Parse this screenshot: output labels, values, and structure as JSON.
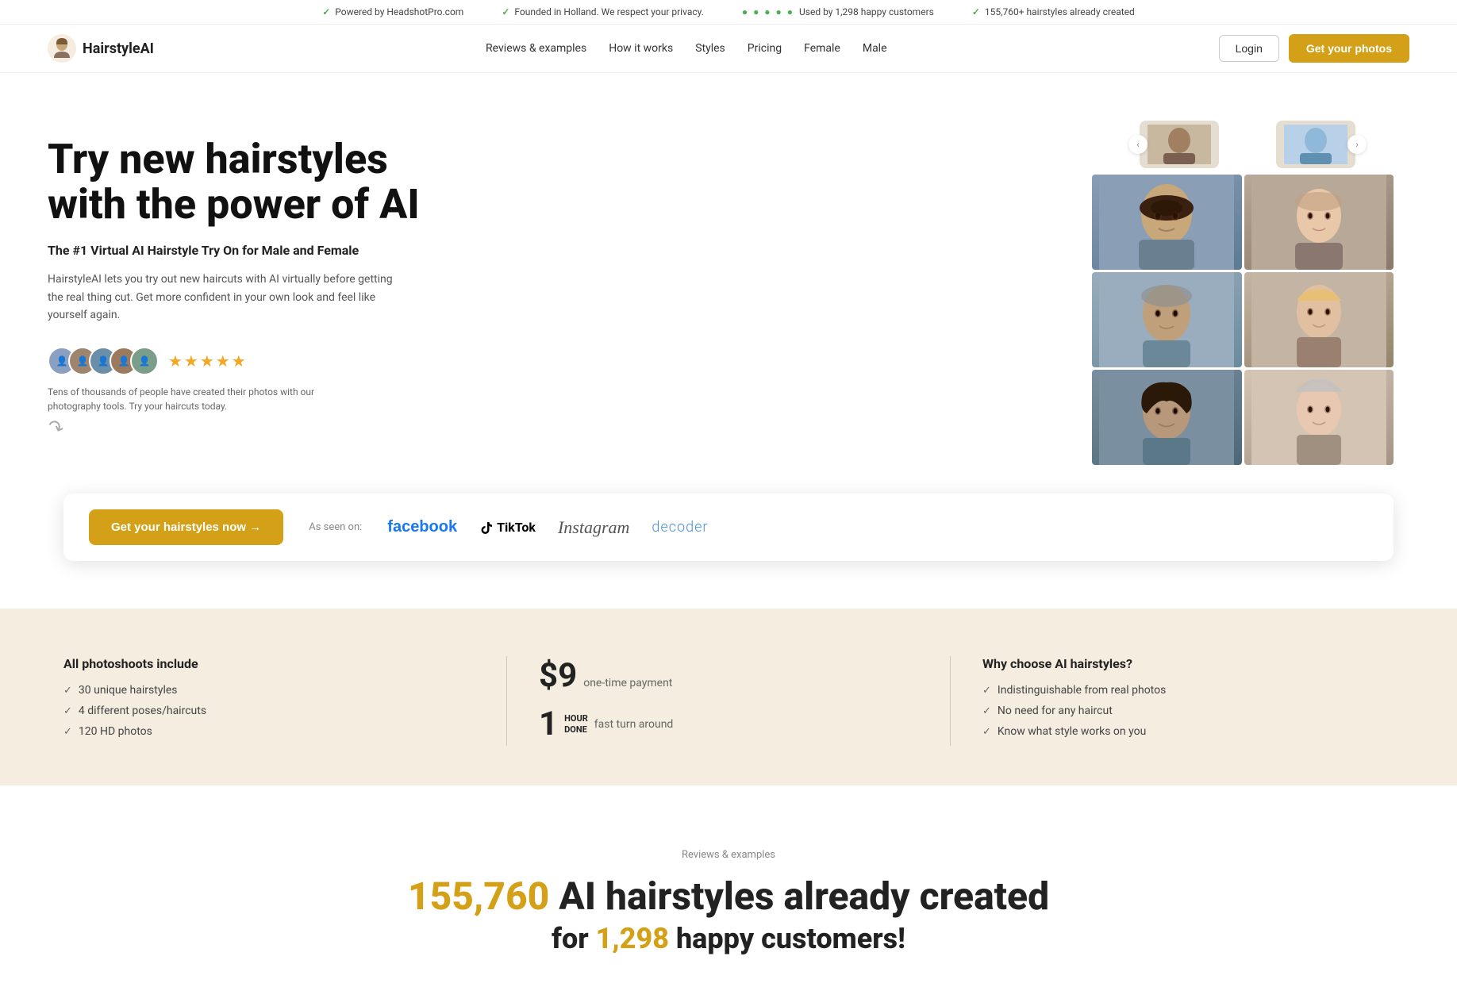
{
  "topbar": {
    "items": [
      {
        "icon": "check",
        "text": "Powered by HeadshotPro.com"
      },
      {
        "icon": "check",
        "text": "Founded in Holland. We respect your privacy."
      },
      {
        "icon": "stars",
        "text": "Used by 1,298 happy customers"
      },
      {
        "icon": "check",
        "text": "155,760+ hairstyles already created"
      }
    ]
  },
  "nav": {
    "logo_text": "HairstyleAI",
    "links": [
      {
        "label": "Reviews & examples",
        "href": "#"
      },
      {
        "label": "How it works",
        "href": "#"
      },
      {
        "label": "Styles",
        "href": "#"
      },
      {
        "label": "Pricing",
        "href": "#"
      },
      {
        "label": "Female",
        "href": "#"
      },
      {
        "label": "Male",
        "href": "#"
      }
    ],
    "login_label": "Login",
    "cta_label": "Get your photos"
  },
  "hero": {
    "title_line1": "Try new hairstyles",
    "title_line2": "with the power of AI",
    "subtitle": "The #1 Virtual AI Hairstyle Try On for Male and Female",
    "description": "HairstyleAI lets you try out new haircuts with AI virtually before getting the real thing cut. Get more confident in your own look and feel like yourself again.",
    "social_proof": "Tens of thousands of people have created their photos with our photography tools. Try your haircuts today.",
    "stars": "★★★★★"
  },
  "social_bar": {
    "cta_label": "Get your hairstyles now →",
    "as_seen_on": "As seen on:",
    "brands": [
      {
        "name": "facebook",
        "display": "facebook"
      },
      {
        "name": "tiktok",
        "display": "TikTok"
      },
      {
        "name": "instagram",
        "display": "Instagram"
      },
      {
        "name": "decoder",
        "display": "decoder"
      }
    ]
  },
  "features": {
    "col1": {
      "title": "All photoshoots include",
      "items": [
        "30 unique hairstyles",
        "4 different poses/haircuts",
        "120 HD photos"
      ]
    },
    "col2": {
      "price": "$9",
      "price_label": "one-time payment",
      "time_num": "1",
      "time_unit": "HOUR\nDONE",
      "time_label": "fast turn around"
    },
    "col3": {
      "title": "Why choose AI hairstyles?",
      "items": [
        "Indistinguishable from real photos",
        "No need for any haircut",
        "Know what style works on you"
      ]
    }
  },
  "stats": {
    "section_label": "Reviews & examples",
    "number": "155,760",
    "title_suffix": "AI hairstyles already created",
    "subtitle": "for 1,298 happy customers!"
  }
}
